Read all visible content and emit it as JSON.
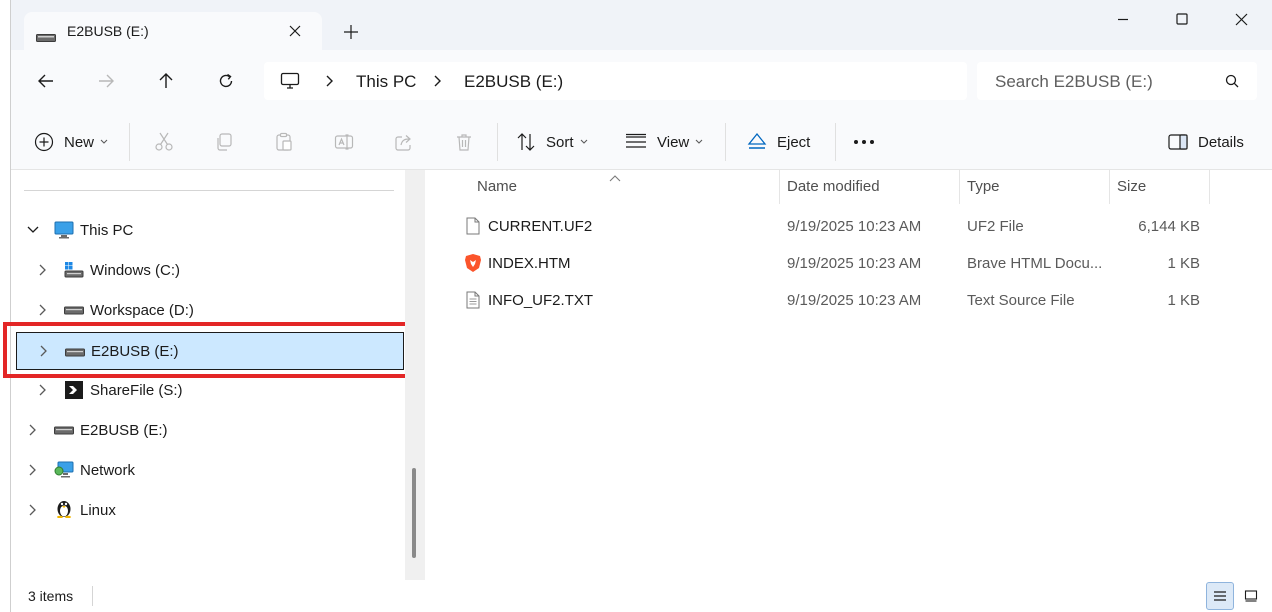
{
  "tab": {
    "title": "E2BUSB (E:)",
    "drive_icon": "usb-drive-icon"
  },
  "window_controls": {
    "minimize": "minimize-icon",
    "maximize": "maximize-icon",
    "close": "close-icon"
  },
  "address": {
    "segments": [
      "This PC",
      "E2BUSB (E:)"
    ]
  },
  "search": {
    "placeholder": "Search E2BUSB (E:)"
  },
  "commands": {
    "new_label": "New",
    "sort_label": "Sort",
    "view_label": "View",
    "eject_label": "Eject",
    "details_label": "Details"
  },
  "nav": {
    "this_pc": "This PC",
    "items": [
      {
        "label": "Windows (C:)",
        "icon": "windows-drive-icon"
      },
      {
        "label": "Workspace (D:)",
        "icon": "drive-icon"
      },
      {
        "label": "E2BUSB (E:)",
        "icon": "usb-drive-icon",
        "selected": true
      },
      {
        "label": "ShareFile (S:)",
        "icon": "sharefile-icon"
      }
    ],
    "root_items": [
      {
        "label": "E2BUSB (E:)",
        "icon": "usb-drive-icon"
      },
      {
        "label": "Network",
        "icon": "network-icon"
      },
      {
        "label": "Linux",
        "icon": "linux-penguin-icon"
      }
    ]
  },
  "columns": {
    "name": "Name",
    "date": "Date modified",
    "type": "Type",
    "size": "Size"
  },
  "files": [
    {
      "name": "CURRENT.UF2",
      "date": "9/19/2025 10:23 AM",
      "type": "UF2 File",
      "size": "6,144 KB",
      "icon": "file-icon"
    },
    {
      "name": "INDEX.HTM",
      "date": "9/19/2025 10:23 AM",
      "type": "Brave HTML Docu...",
      "size": "1 KB",
      "icon": "brave-browser-icon"
    },
    {
      "name": "INFO_UF2.TXT",
      "date": "9/19/2025 10:23 AM",
      "type": "Text Source File",
      "size": "1 KB",
      "icon": "text-file-icon"
    }
  ],
  "status": {
    "item_count": "3 items"
  },
  "colors": {
    "selection": "#cce8ff",
    "highlight_box": "#e32626",
    "accent": "#0067c0"
  }
}
